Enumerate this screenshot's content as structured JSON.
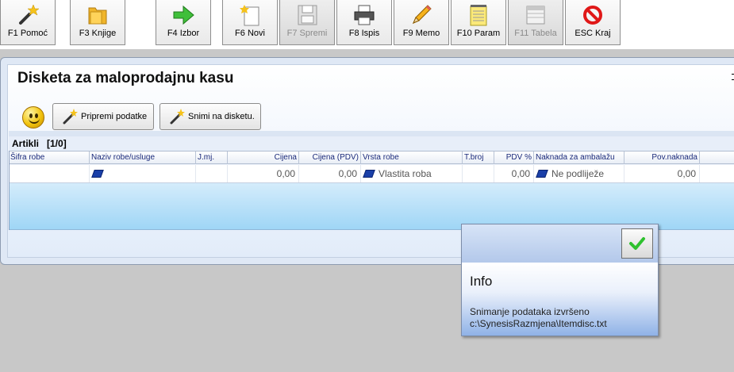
{
  "toolbar": {
    "buttons": [
      {
        "label": "F1 Pomoć",
        "icon": "magic-wand-icon",
        "enabled": true
      },
      {
        "label": "F3 Knjige",
        "icon": "folder-icon",
        "enabled": true
      },
      {
        "label": "F4 Izbor",
        "icon": "green-arrow-icon",
        "enabled": true
      },
      {
        "label": "F6 Novi",
        "icon": "new-document-icon",
        "enabled": true
      },
      {
        "label": "F7 Spremi",
        "icon": "floppy-disk-icon",
        "enabled": false
      },
      {
        "label": "F8 Ispis",
        "icon": "printer-icon",
        "enabled": true
      },
      {
        "label": "F9 Memo",
        "icon": "pencil-icon",
        "enabled": true
      },
      {
        "label": "F10 Param",
        "icon": "notepad-icon",
        "enabled": true
      },
      {
        "label": "F11 Tabela",
        "icon": "table-icon",
        "enabled": false
      },
      {
        "label": "ESC Kraj",
        "icon": "stop-icon",
        "enabled": true
      }
    ]
  },
  "panel": {
    "title": "Disketa za maloprodajnu kasu",
    "prepare_button": "Pripremi podatke",
    "save_button": "Snimi na disketu."
  },
  "grid": {
    "caption": "Artikli",
    "count": "[1/0]",
    "columns": [
      "Šifra robe",
      "Naziv robe/usluge",
      "J.mj.",
      "Cijena",
      "Cijena (PDV)",
      "Vrsta robe",
      "T.broj",
      "PDV %",
      "Naknada za ambalažu",
      "Pov.naknada"
    ],
    "row": {
      "sifra": "",
      "naziv": "",
      "jmj": "",
      "cijena": "0,00",
      "cijena_pdv": "0,00",
      "vrsta": "Vlastita roba",
      "tbroj": "",
      "pdv": "0,00",
      "naknada": "Ne podliježe",
      "pov_naknada": "0,00"
    }
  },
  "info": {
    "title": "Info",
    "line1": "Snimanje podataka izvršeno",
    "line2": "c:\\SynesisRazmjena\\Itemdisc.txt"
  },
  "colors": {
    "accent": "#1a3fa8",
    "panel_bg": "#dfe8f5",
    "grid_fill": "#9fd6f6"
  }
}
